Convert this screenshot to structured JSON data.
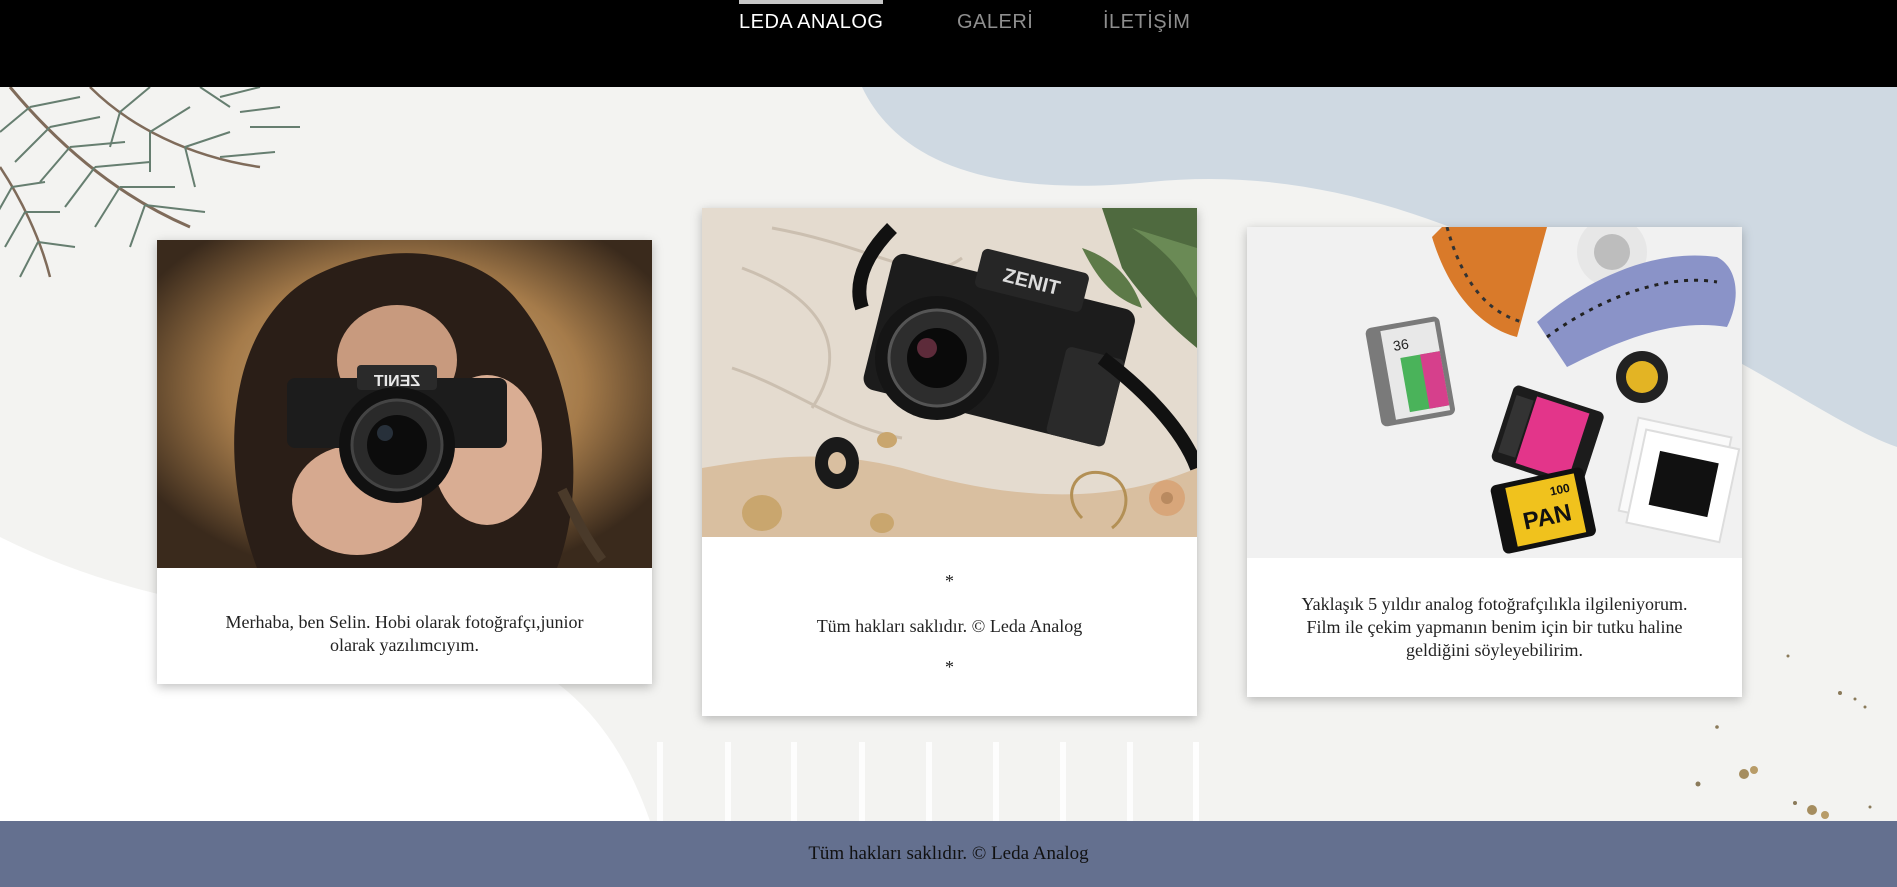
{
  "nav": {
    "items": [
      {
        "label": "LEDA ANALOG",
        "active": true
      },
      {
        "label": "GALERİ",
        "active": false
      },
      {
        "label": "İLETİŞİM",
        "active": false
      }
    ]
  },
  "cards": [
    {
      "image_alt": "woman-holding-zenit-camera",
      "text": "Merhaba, ben Selin. Hobi olarak fotoğrafçı,junior olarak yazılımcıyım."
    },
    {
      "image_alt": "zenit-camera-on-fabric",
      "lines": [
        "*",
        "Tüm hakları saklıdır. © Leda Analog",
        "*"
      ]
    },
    {
      "image_alt": "film-rolls-and-slides",
      "text": "Yaklaşık 5 yıldır analog fotoğrafçılıkla ilgileniyorum. Film ile çekim yapmanın benim için bir tutku haline geldiğini söyleyebilirim.",
      "film_label": "PAN",
      "film_number": "100",
      "film_count": "36"
    }
  ],
  "footer": {
    "text": "Tüm hakları saklıdır. © Leda Analog"
  },
  "colors": {
    "navbar": "#000000",
    "nav_active": "#ffffff",
    "nav_inactive": "#8e8e8e",
    "footer": "#64708f",
    "blob_blue": "#cfd9e2",
    "background": "#f3f3f1"
  }
}
